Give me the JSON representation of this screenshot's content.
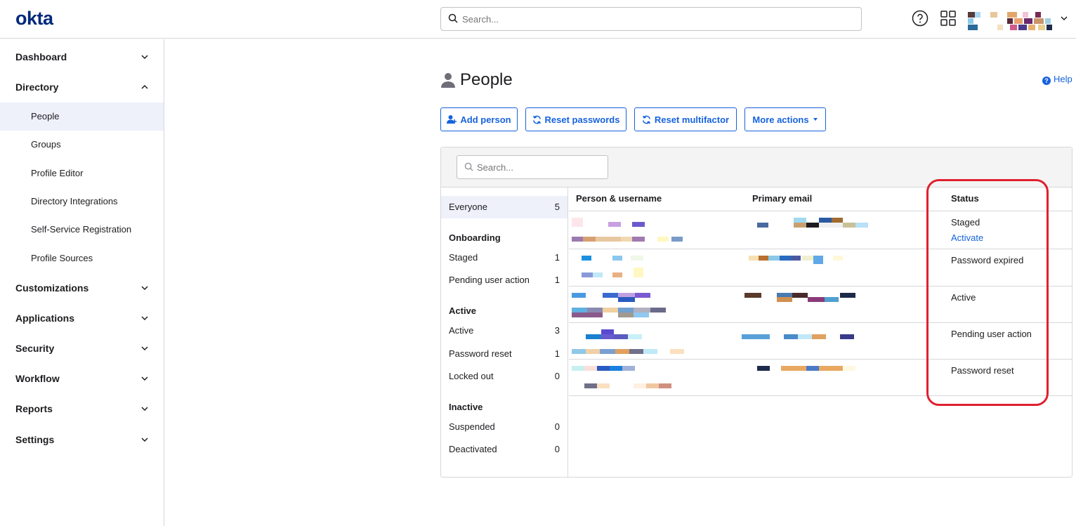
{
  "header": {
    "logo": "okta",
    "search_placeholder": "Search...",
    "help_icon": "question-circle-icon",
    "apps_icon": "grid-icon",
    "user_menu_icon": "chevron-down-icon"
  },
  "sidebar": {
    "sections": [
      {
        "label": "Dashboard",
        "expanded": false
      },
      {
        "label": "Directory",
        "expanded": true,
        "items": [
          "People",
          "Groups",
          "Profile Editor",
          "Directory Integrations",
          "Self-Service Registration",
          "Profile Sources"
        ],
        "active_item": "People"
      },
      {
        "label": "Customizations",
        "expanded": false
      },
      {
        "label": "Applications",
        "expanded": false
      },
      {
        "label": "Security",
        "expanded": false
      },
      {
        "label": "Workflow",
        "expanded": false
      },
      {
        "label": "Reports",
        "expanded": false
      },
      {
        "label": "Settings",
        "expanded": false
      }
    ]
  },
  "page": {
    "title": "People",
    "title_icon": "person-icon",
    "help_label": "Help",
    "actions": {
      "add_person": "Add person",
      "reset_passwords": "Reset passwords",
      "reset_multifactor": "Reset multifactor",
      "more_actions": "More actions"
    }
  },
  "panel": {
    "search_placeholder": "Search...",
    "filters": {
      "everyone": {
        "label": "Everyone",
        "count": "5"
      },
      "groups": [
        {
          "heading": "Onboarding",
          "items": [
            {
              "label": "Staged",
              "count": "1"
            },
            {
              "label": "Pending user action",
              "count": "1"
            }
          ]
        },
        {
          "heading": "Active",
          "items": [
            {
              "label": "Active",
              "count": "3"
            },
            {
              "label": "Password reset",
              "count": "1"
            },
            {
              "label": "Locked out",
              "count": "0"
            }
          ]
        },
        {
          "heading": "Inactive",
          "items": [
            {
              "label": "Suspended",
              "count": "0"
            },
            {
              "label": "Deactivated",
              "count": "0"
            }
          ]
        }
      ]
    },
    "table": {
      "columns": [
        "Person & username",
        "Primary email",
        "Status"
      ],
      "rows": [
        {
          "status": "Staged",
          "action": "Activate"
        },
        {
          "status": "Password expired",
          "action": ""
        },
        {
          "status": "Active",
          "action": ""
        },
        {
          "status": "Pending user action",
          "action": ""
        },
        {
          "status": "Password reset",
          "action": ""
        }
      ]
    }
  },
  "annotation": {
    "highlight_color": "#e0202e"
  },
  "colors": {
    "brand": "#00297a",
    "accent": "#1662dd"
  }
}
